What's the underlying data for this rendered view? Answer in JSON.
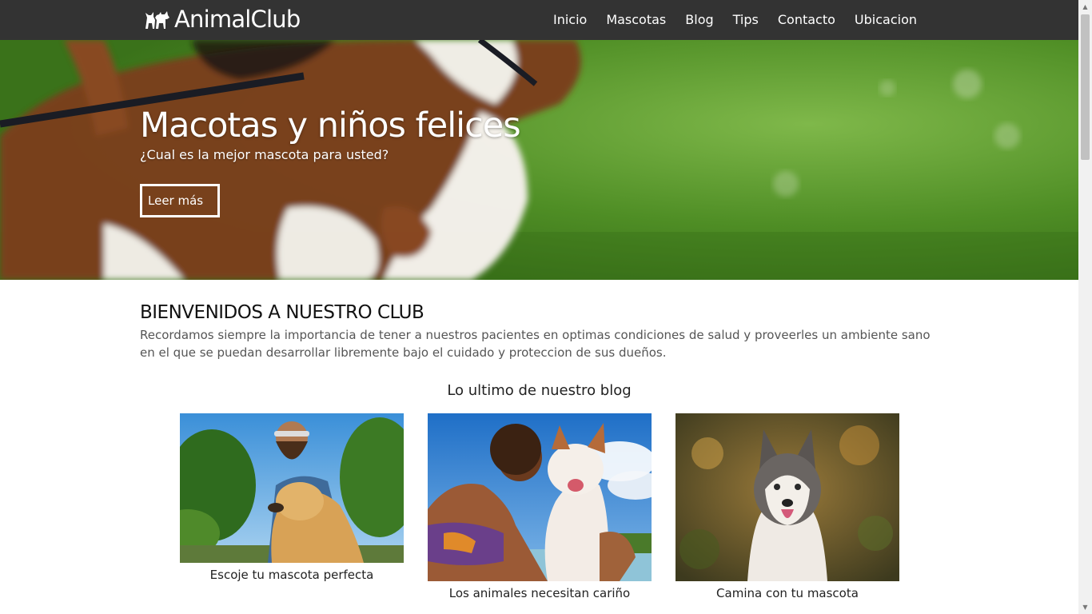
{
  "brand": {
    "name": "AnimalClub",
    "icon": "dog-cat-logo-icon"
  },
  "nav": {
    "items": [
      {
        "label": "Inicio"
      },
      {
        "label": "Mascotas"
      },
      {
        "label": "Blog"
      },
      {
        "label": "Tips"
      },
      {
        "label": "Contacto"
      },
      {
        "label": "Ubicacion"
      }
    ]
  },
  "hero": {
    "title": "Macotas y niños felices",
    "subtitle": "¿Cual es la mejor mascota para usted?",
    "button_label": "Leer más"
  },
  "welcome": {
    "heading": "BIENVENIDOS A NUESTRO CLUB",
    "text": "Recordamos siempre la importancia de tener a nuestros pacientes en optimas condiciones de salud y proveerles un ambiente sano en el que se puedan desarrollar libremente bajo el cuidado y proteccion de sus dueños."
  },
  "blog": {
    "title": "Lo ultimo de nuestro blog",
    "posts": [
      {
        "caption": "Escoje tu mascota perfecta"
      },
      {
        "caption": "Los animales necesitan cariño"
      },
      {
        "caption": "Camina con tu mascota"
      }
    ]
  },
  "colors": {
    "navbar": "#333333",
    "accent_text": "#ffffff",
    "body_text": "#555555"
  }
}
